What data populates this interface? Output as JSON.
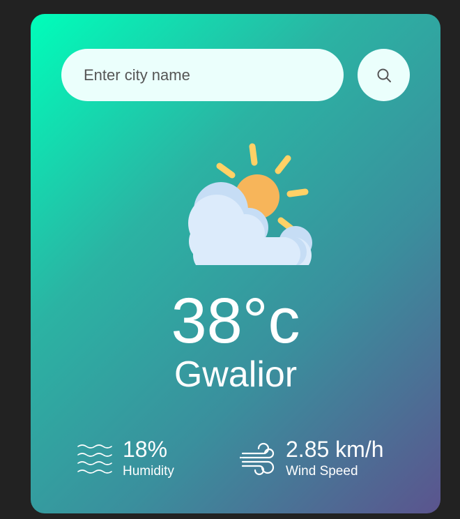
{
  "search": {
    "placeholder": "Enter city name",
    "value": "",
    "button_icon": "search-icon"
  },
  "weather": {
    "icon": "partly-cloudy-icon",
    "temperature": "38°c",
    "city": "Gwalior"
  },
  "details": {
    "humidity": {
      "icon": "humidity-waves-icon",
      "value": "18%",
      "label": "Humidity"
    },
    "wind": {
      "icon": "wind-icon",
      "value": "2.85 km/h",
      "label": "Wind Speed"
    }
  },
  "colors": {
    "page_background": "#222222",
    "card_gradient_start": "#00feba",
    "card_gradient_end": "#5b548e",
    "input_background": "#ebfffc",
    "text": "#ffffff"
  }
}
